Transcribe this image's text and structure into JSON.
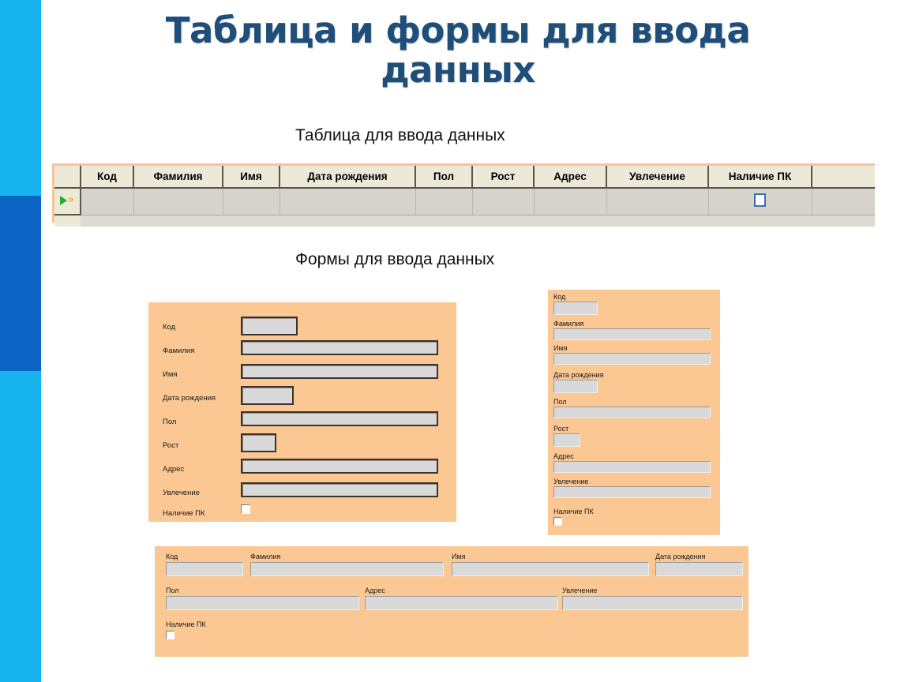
{
  "slide": {
    "title": "Таблица и формы для ввода данных",
    "title_color": "#1f4e79",
    "subtitle_table": "Таблица для ввода данных",
    "subtitle_forms": "Формы для ввода данных",
    "accent_cyan": "#16b3ee",
    "accent_blue": "#0b63c4",
    "form_background": "#fbc894"
  },
  "datasheet": {
    "columns": [
      "Код",
      "Фамилия",
      "Имя",
      "Дата рождения",
      "Пол",
      "Рост",
      "Адрес",
      "Увлечение",
      "Наличие ПК"
    ],
    "record_selector_icon": "new-record-arrow-icon",
    "row": {
      "Код": "",
      "Фамилия": "",
      "Имя": "",
      "Дата рождения": "",
      "Пол": "",
      "Рост": "",
      "Адрес": "",
      "Увлечение": "",
      "Наличие ПК": false
    }
  },
  "form_columnar": {
    "fields": [
      {
        "label": "Код",
        "value": ""
      },
      {
        "label": "Фамилия",
        "value": ""
      },
      {
        "label": "Имя",
        "value": ""
      },
      {
        "label": "Дата рождения",
        "value": ""
      },
      {
        "label": "Пол",
        "value": ""
      },
      {
        "label": "Рост",
        "value": ""
      },
      {
        "label": "Адрес",
        "value": ""
      },
      {
        "label": "Увлечение",
        "value": ""
      },
      {
        "label": "Наличие ПК",
        "value": false
      }
    ]
  },
  "form_stacked": {
    "fields": [
      {
        "label": "Код",
        "value": ""
      },
      {
        "label": "Фамилия",
        "value": ""
      },
      {
        "label": "Имя",
        "value": ""
      },
      {
        "label": "Дата рождения",
        "value": ""
      },
      {
        "label": "Пол",
        "value": ""
      },
      {
        "label": "Рост",
        "value": ""
      },
      {
        "label": "Адрес",
        "value": ""
      },
      {
        "label": "Увлечение",
        "value": ""
      },
      {
        "label": "Наличие ПК",
        "value": false
      }
    ]
  },
  "form_tabular": {
    "fields": [
      {
        "label": "Код",
        "value": ""
      },
      {
        "label": "Фамилия",
        "value": ""
      },
      {
        "label": "Имя",
        "value": ""
      },
      {
        "label": "Дата рождения",
        "value": ""
      },
      {
        "label": "Пол",
        "value": ""
      },
      {
        "label": "Адрес",
        "value": ""
      },
      {
        "label": "Увлечение",
        "value": ""
      },
      {
        "label": "Наличие ПК",
        "value": false
      }
    ]
  }
}
